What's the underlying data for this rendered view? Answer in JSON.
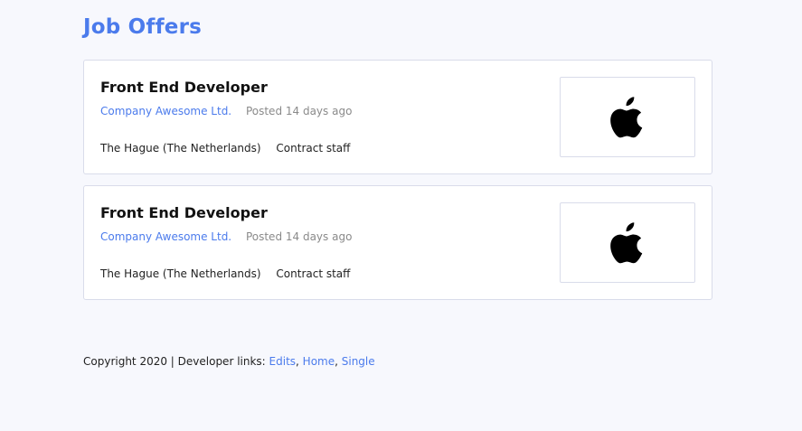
{
  "page": {
    "title": "Job Offers"
  },
  "offers": [
    {
      "title": "Front End Developer",
      "company": "Company Awesome Ltd.",
      "posted": "Posted 14 days ago",
      "location": "The Hague (The Netherlands)",
      "contract": "Contract staff",
      "logo_icon": "apple-logo-icon"
    },
    {
      "title": "Front End Developer",
      "company": "Company Awesome Ltd.",
      "posted": "Posted 14 days ago",
      "location": "The Hague (The Netherlands)",
      "contract": "Contract staff",
      "logo_icon": "apple-logo-icon"
    }
  ],
  "footer": {
    "copyright": "Copyright 2020 | Developer links: ",
    "links": [
      "Edits",
      "Home",
      "Single"
    ],
    "separator": ", "
  },
  "colors": {
    "accent": "#4b7bec",
    "background": "#f7f8fd",
    "card_border": "#d9dcea"
  }
}
